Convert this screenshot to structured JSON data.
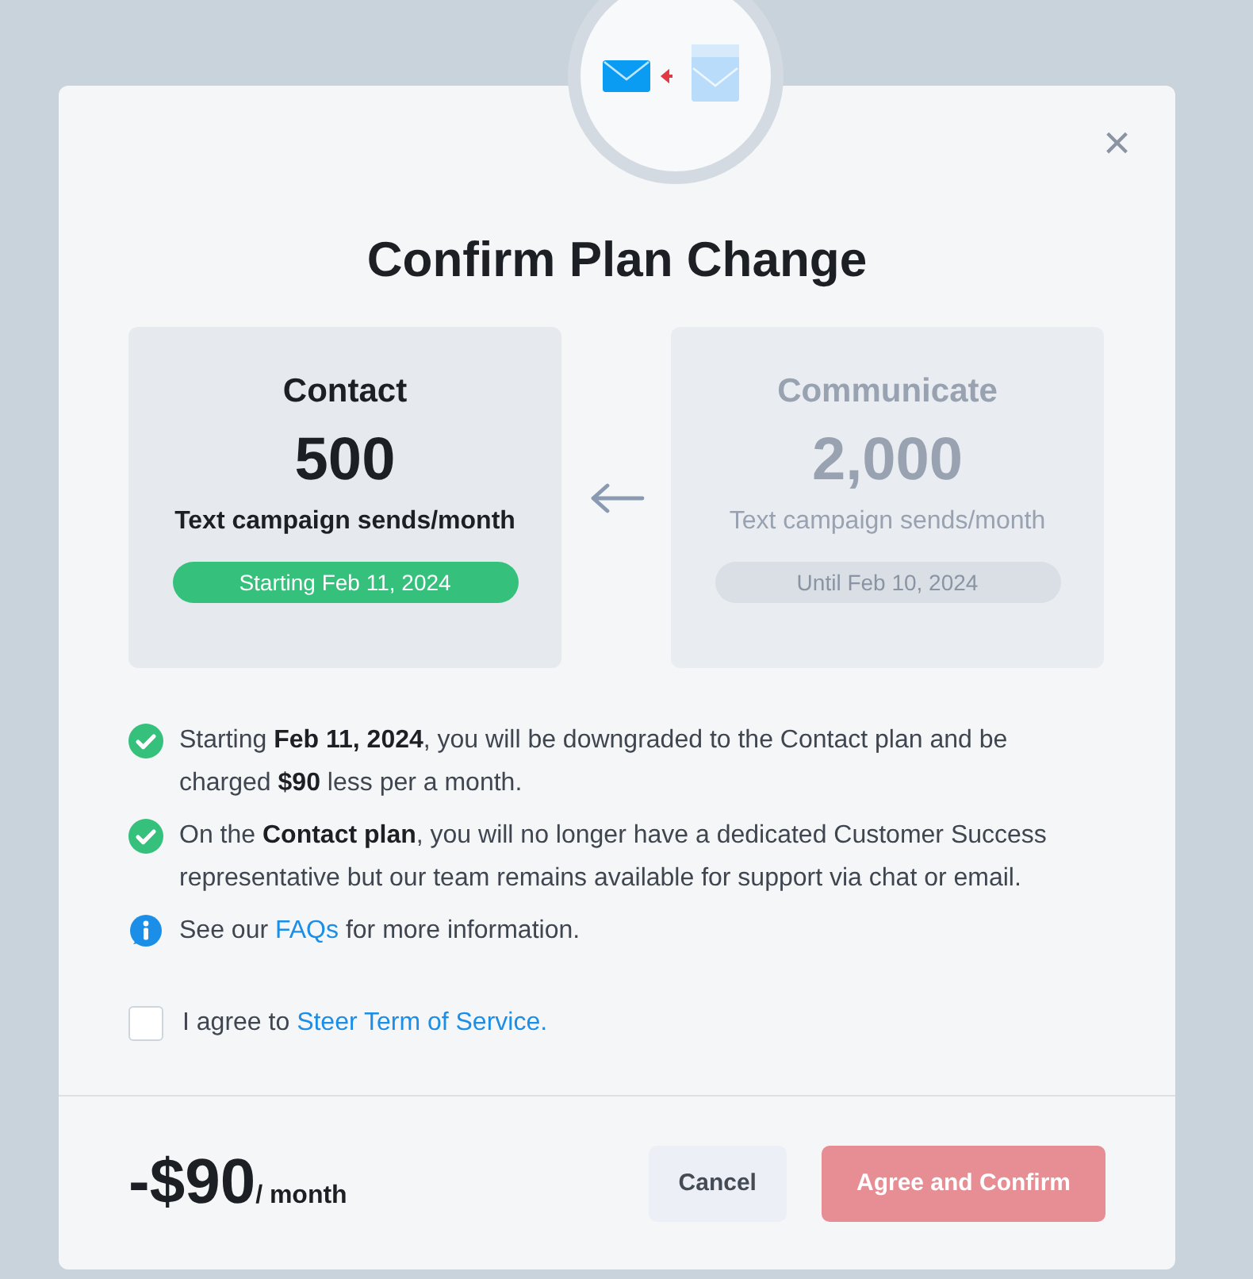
{
  "dialog": {
    "title": "Confirm Plan Change",
    "close": "×",
    "plans": [
      {
        "kind": "new",
        "name": "Contact",
        "amount": "500",
        "unit": "Text campaign sends/month",
        "date": "Starting Feb 11, 2024"
      },
      {
        "kind": "old",
        "name": "Communicate",
        "amount": "2,000",
        "unit": "Text campaign sends/month",
        "date": "Until Feb 10, 2024"
      }
    ],
    "notes": [
      {
        "kind": "check",
        "text": "Starting **Feb 11, 2024**, you will be downgraded to the Contact plan and be charged **$90** less per a month."
      },
      {
        "kind": "check",
        "text": "On the **Contact plan**, you will no longer have a dedicated Customer Success representative but our team remains available for support via chat or email."
      },
      {
        "kind": "info",
        "text": "See our ",
        "link": "FAQs",
        "after": " for more information."
      }
    ],
    "agreement": {
      "checked": false,
      "label": "I agree to",
      "link": "Steer Term of Service."
    },
    "price": {
      "amount": "-$90",
      "period": "/ month"
    },
    "buttons": [
      {
        "kind": "secondary",
        "label": "Cancel",
        "disabled": false
      },
      {
        "kind": "primary",
        "label": "Agree and Confirm",
        "disabled": true
      }
    ]
  }
}
